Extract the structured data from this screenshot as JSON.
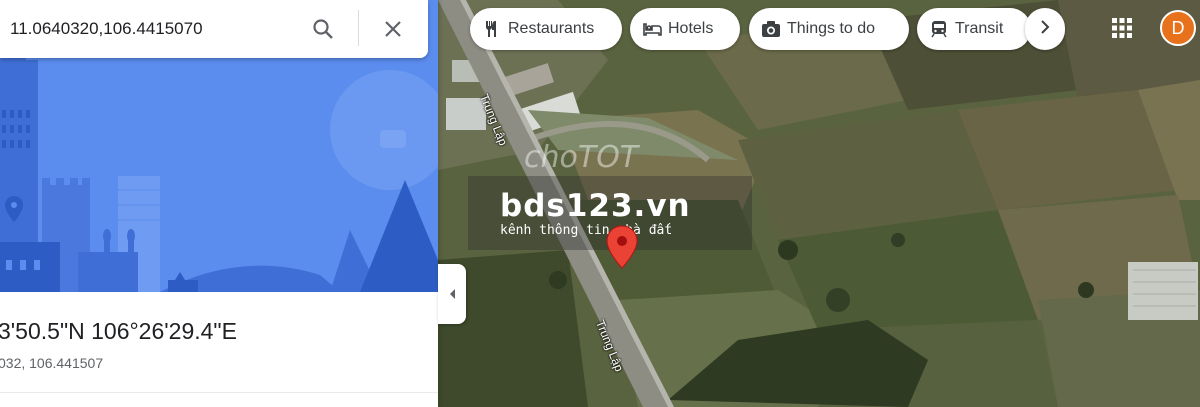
{
  "search": {
    "value": "11.0640320,106.4415070"
  },
  "place": {
    "title": "3'50.5\"N 106°26'29.4\"E",
    "subtitle": "032, 106.441507"
  },
  "chips": {
    "restaurants": "Restaurants",
    "hotels": "Hotels",
    "things_to_do": "Things to do",
    "transit": "Transit"
  },
  "avatar": {
    "initial": "D",
    "color": "#e8711c"
  },
  "map": {
    "road_label_1": "Trung Lập",
    "road_label_2": "Trung Lập"
  },
  "watermark": {
    "logo": "choTOT",
    "main": "bds123.vn",
    "sub": "kênh thông tin nhà đất"
  },
  "icons": {
    "search": "search-icon",
    "close": "close-icon",
    "restaurants": "fork-knife-icon",
    "hotels": "bed-icon",
    "things_to_do": "camera-icon",
    "transit": "train-icon",
    "next": "chevron-right-icon",
    "collapse": "chevron-left-icon",
    "apps": "apps-grid-icon",
    "pin": "map-pin-icon"
  },
  "colors": {
    "hero": "#5b8def",
    "pin": "#ea4335",
    "accent": "#1a73e8"
  }
}
